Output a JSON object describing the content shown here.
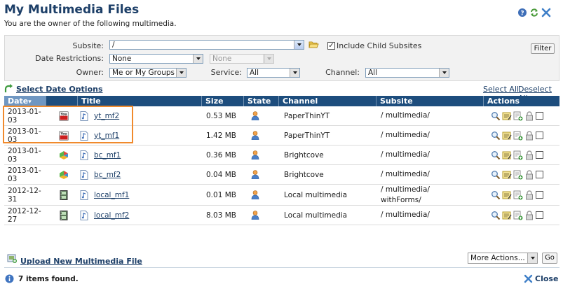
{
  "header": {
    "title": "My Multimedia Files",
    "subtitle": "You are the owner of the following multimedia.",
    "icons": [
      "help-icon",
      "refresh-icon",
      "close-icon"
    ]
  },
  "filters": {
    "subsite_label": "Subsite:",
    "subsite_value": "/",
    "include_child_label": "Include Child Subsites",
    "include_child_checked": true,
    "filter_button": "Filter",
    "date_label": "Date Restrictions:",
    "date_value": "None",
    "date_value2": "None",
    "owner_label": "Owner:",
    "owner_value": "Me or My Groups",
    "service_label": "Service:",
    "service_value": "All",
    "channel_label": "Channel:",
    "channel_value": "All"
  },
  "links": {
    "select_date_options": "Select Date Options",
    "select_all": "Select All",
    "deselect_all": "Deselect All"
  },
  "table": {
    "columns": [
      "Date",
      "Title",
      "Size",
      "State",
      "Channel",
      "Subsite",
      "Actions"
    ],
    "sort_indicator": "▾",
    "rows": [
      {
        "date": "2013-01-03",
        "service_icon": "youtube-icon",
        "title": "yt_mf2",
        "size": "0.53 MB",
        "channel": "PaperThinYT",
        "subsite": "/ multimedia/"
      },
      {
        "date": "2013-01-03",
        "service_icon": "youtube-icon",
        "title": "yt_mf1",
        "size": "1.42 MB",
        "channel": "PaperThinYT",
        "subsite": "/ multimedia/"
      },
      {
        "date": "2013-01-03",
        "service_icon": "brightcove-icon",
        "title": "bc_mf1",
        "size": "0.36 MB",
        "channel": "Brightcove",
        "subsite": "/ multimedia/"
      },
      {
        "date": "2013-01-03",
        "service_icon": "brightcove-icon",
        "title": "bc_mf2",
        "size": "0.04 MB",
        "channel": "Brightcove",
        "subsite": "/ multimedia/"
      },
      {
        "date": "2012-12-31",
        "service_icon": "film-icon",
        "title": "local_mf1",
        "size": "0.01 MB",
        "channel": "Local multimedia",
        "subsite": "/ multimedia/",
        "subsite2": "withForms/"
      },
      {
        "date": "2012-12-27",
        "service_icon": "film-icon",
        "title": "local_mf2",
        "size": "8.03 MB",
        "channel": "Local multimedia",
        "subsite": "/ multimedia/"
      }
    ]
  },
  "footer": {
    "upload_link": "Upload New Multimedia File",
    "more_actions": "More Actions...",
    "go_button": "Go",
    "status": "7 items found.",
    "close": "Close"
  },
  "colors": {
    "header_bg": "#1d4d7d",
    "title_color": "#1d3f68",
    "highlight": "#f08a2c"
  }
}
